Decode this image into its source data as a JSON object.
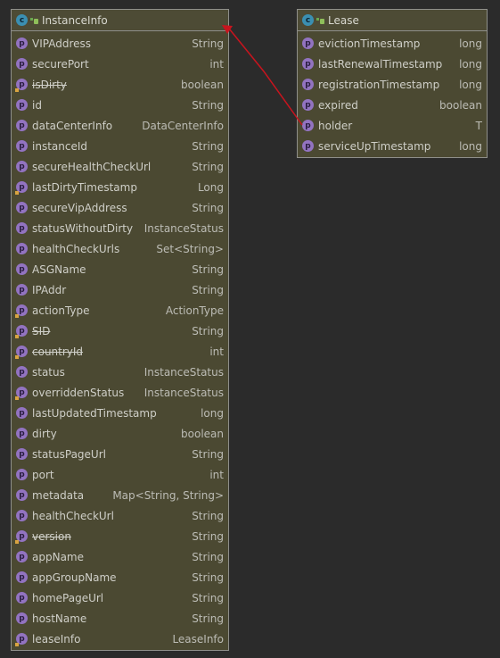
{
  "classes": [
    {
      "id": "instanceinfo",
      "icon": "class-icon",
      "icon_letter": "c",
      "name": "InstanceInfo",
      "fields": [
        {
          "name": "VIPAddress",
          "type": "String",
          "deprecated": false,
          "badge": false
        },
        {
          "name": "securePort",
          "type": "int",
          "deprecated": false,
          "badge": false
        },
        {
          "name": "isDirty",
          "type": "boolean",
          "deprecated": true,
          "badge": true
        },
        {
          "name": "id",
          "type": "String",
          "deprecated": false,
          "badge": false
        },
        {
          "name": "dataCenterInfo",
          "type": "DataCenterInfo",
          "deprecated": false,
          "badge": false
        },
        {
          "name": "instanceId",
          "type": "String",
          "deprecated": false,
          "badge": false
        },
        {
          "name": "secureHealthCheckUrl",
          "type": "String",
          "deprecated": false,
          "badge": false
        },
        {
          "name": "lastDirtyTimestamp",
          "type": "Long",
          "deprecated": false,
          "badge": true
        },
        {
          "name": "secureVipAddress",
          "type": "String",
          "deprecated": false,
          "badge": false
        },
        {
          "name": "statusWithoutDirty",
          "type": "InstanceStatus",
          "deprecated": false,
          "badge": false
        },
        {
          "name": "healthCheckUrls",
          "type": "Set<String>",
          "deprecated": false,
          "badge": false
        },
        {
          "name": "ASGName",
          "type": "String",
          "deprecated": false,
          "badge": false
        },
        {
          "name": "IPAddr",
          "type": "String",
          "deprecated": false,
          "badge": false
        },
        {
          "name": "actionType",
          "type": "ActionType",
          "deprecated": false,
          "badge": true
        },
        {
          "name": "SID",
          "type": "String",
          "deprecated": true,
          "badge": true
        },
        {
          "name": "countryId",
          "type": "int",
          "deprecated": true,
          "badge": true
        },
        {
          "name": "status",
          "type": "InstanceStatus",
          "deprecated": false,
          "badge": false
        },
        {
          "name": "overriddenStatus",
          "type": "InstanceStatus",
          "deprecated": false,
          "badge": true
        },
        {
          "name": "lastUpdatedTimestamp",
          "type": "long",
          "deprecated": false,
          "badge": false
        },
        {
          "name": "dirty",
          "type": "boolean",
          "deprecated": false,
          "badge": false
        },
        {
          "name": "statusPageUrl",
          "type": "String",
          "deprecated": false,
          "badge": false
        },
        {
          "name": "port",
          "type": "int",
          "deprecated": false,
          "badge": false
        },
        {
          "name": "metadata",
          "type": "Map<String, String>",
          "deprecated": false,
          "badge": false
        },
        {
          "name": "healthCheckUrl",
          "type": "String",
          "deprecated": false,
          "badge": false
        },
        {
          "name": "version",
          "type": "String",
          "deprecated": true,
          "badge": true
        },
        {
          "name": "appName",
          "type": "String",
          "deprecated": false,
          "badge": false
        },
        {
          "name": "appGroupName",
          "type": "String",
          "deprecated": false,
          "badge": false
        },
        {
          "name": "homePageUrl",
          "type": "String",
          "deprecated": false,
          "badge": false
        },
        {
          "name": "hostName",
          "type": "String",
          "deprecated": false,
          "badge": false
        },
        {
          "name": "leaseInfo",
          "type": "LeaseInfo",
          "deprecated": false,
          "badge": true
        }
      ]
    },
    {
      "id": "lease",
      "icon": "class-icon",
      "icon_letter": "c",
      "name": "Lease",
      "fields": [
        {
          "name": "evictionTimestamp",
          "type": "long",
          "deprecated": false,
          "badge": false
        },
        {
          "name": "lastRenewalTimestamp",
          "type": "long",
          "deprecated": false,
          "badge": false
        },
        {
          "name": "registrationTimestamp",
          "type": "long",
          "deprecated": false,
          "badge": false
        },
        {
          "name": "expired",
          "type": "boolean",
          "deprecated": false,
          "badge": false
        },
        {
          "name": "holder",
          "type": "T",
          "deprecated": false,
          "badge": false
        },
        {
          "name": "serviceUpTimestamp",
          "type": "long",
          "deprecated": false,
          "badge": false
        }
      ]
    }
  ],
  "field_icon_letter": "p",
  "relation": {
    "from_class": "Lease",
    "from_field": "holder",
    "to_class": "InstanceInfo",
    "color": "#c8141e"
  },
  "colors": {
    "background": "#2b2b2b",
    "box_fill": "#4b4932",
    "class_icon": "#3b8fb1",
    "field_icon": "#9273c0",
    "arrow": "#c8141e"
  }
}
